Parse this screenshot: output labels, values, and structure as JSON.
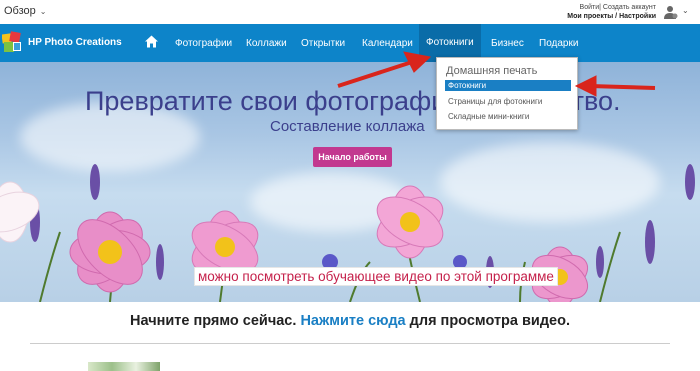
{
  "topbar": {
    "overview_label": "Обзор",
    "account_line1": "Войти| Создать аккаунт",
    "account_line2": "Мои проекты / Настройки"
  },
  "nav": {
    "brand": "HP Photo Creations",
    "items": [
      "Фотографии",
      "Коллажи",
      "Открытки",
      "Календари",
      "Фотокниги",
      "Бизнес",
      "Подарки"
    ],
    "active_index": 4,
    "bar_color": "#0d84c9"
  },
  "dropdown": {
    "header": "Домашняя печать",
    "items": [
      "Фотокниги",
      "Страницы для фотокниги",
      "Складные мини-книги"
    ],
    "selected_index": 0
  },
  "hero": {
    "title": "Превратите свои фотографии в искусство.",
    "subtitle": "Составление коллажа",
    "button": "Начало работы",
    "button_color": "#c2388f",
    "annotation": "можно посмотреть обучающее видео по этой программе"
  },
  "cta": {
    "prefix": "Начните прямо сейчас.",
    "link": "Нажмите сюда",
    "suffix": "для просмотра видео."
  },
  "icons": {
    "overview_chevron": "chevron-down-icon",
    "home": "home-icon",
    "user": "user-icon",
    "logo": "hp-photo-creations-logo"
  },
  "colors": {
    "annotation_text": "#c5214b",
    "arrow": "#d9251c",
    "link": "#1a7fc4"
  }
}
